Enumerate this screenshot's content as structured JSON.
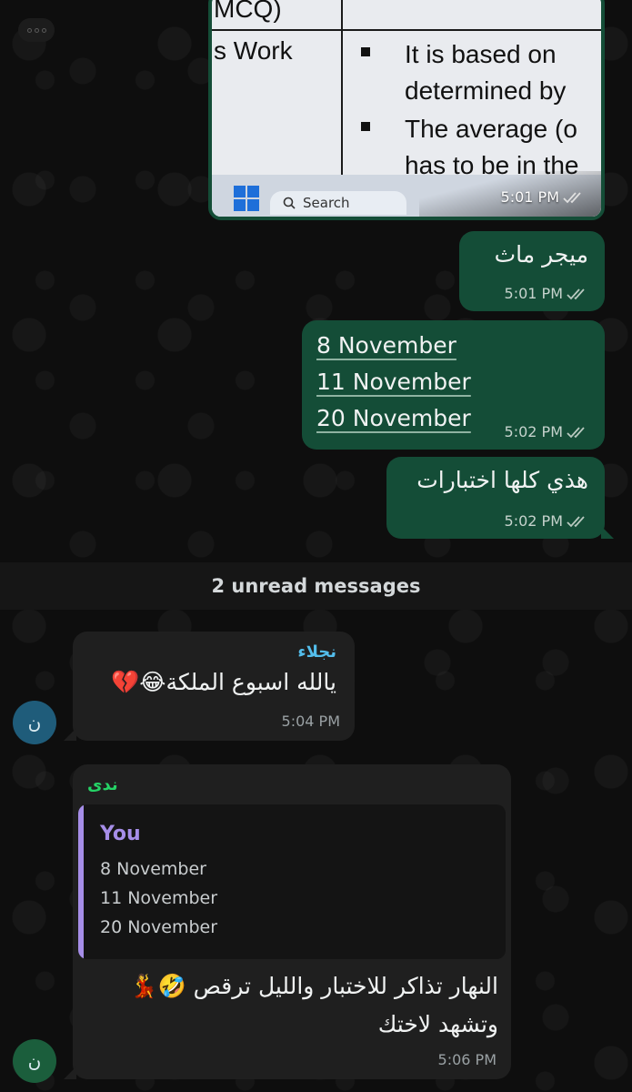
{
  "image_message": {
    "doc_row1": "MCQ)",
    "doc_row2_left": "s Work",
    "doc_lines": [
      "It is based on",
      "determined by",
      "The average (o",
      "has to be in the"
    ],
    "taskbar_search": "Search",
    "time": "5:01 PM",
    "icon": "double-check-icon"
  },
  "outgoing": [
    {
      "text": "ميجر ماث",
      "time": "5:01 PM"
    },
    {
      "lines": [
        "8 November",
        "11 November",
        "20 November"
      ],
      "time": "5:02 PM"
    },
    {
      "text": "هذي كلها اختبارات",
      "time": "5:02 PM"
    }
  ],
  "unread_banner": "2 unread messages",
  "incoming": [
    {
      "sender": "نجلاء",
      "sender_color": "#53bdeb",
      "text": "يالله اسبوع الملكة😂💔",
      "time": "5:04 PM",
      "avatar_letter": "ن",
      "avatar_color": "#1f5c7a"
    },
    {
      "sender": "ندى",
      "sender_color": "#25d366",
      "quote_author": "You",
      "quote_lines": [
        "8 November",
        "11 November",
        "20 November"
      ],
      "text_line1": "النهار تذاكر للاختبار والليل ترقص 🤣💃",
      "text_line2": "وتشهد لاختك",
      "time": "5:06 PM",
      "avatar_letter": "ن",
      "avatar_color": "#1b5e3c"
    }
  ],
  "colors": {
    "outgoing_bubble": "#144d37",
    "incoming_bubble": "#1f1f1f",
    "quote_accent": "#a68ee8"
  }
}
